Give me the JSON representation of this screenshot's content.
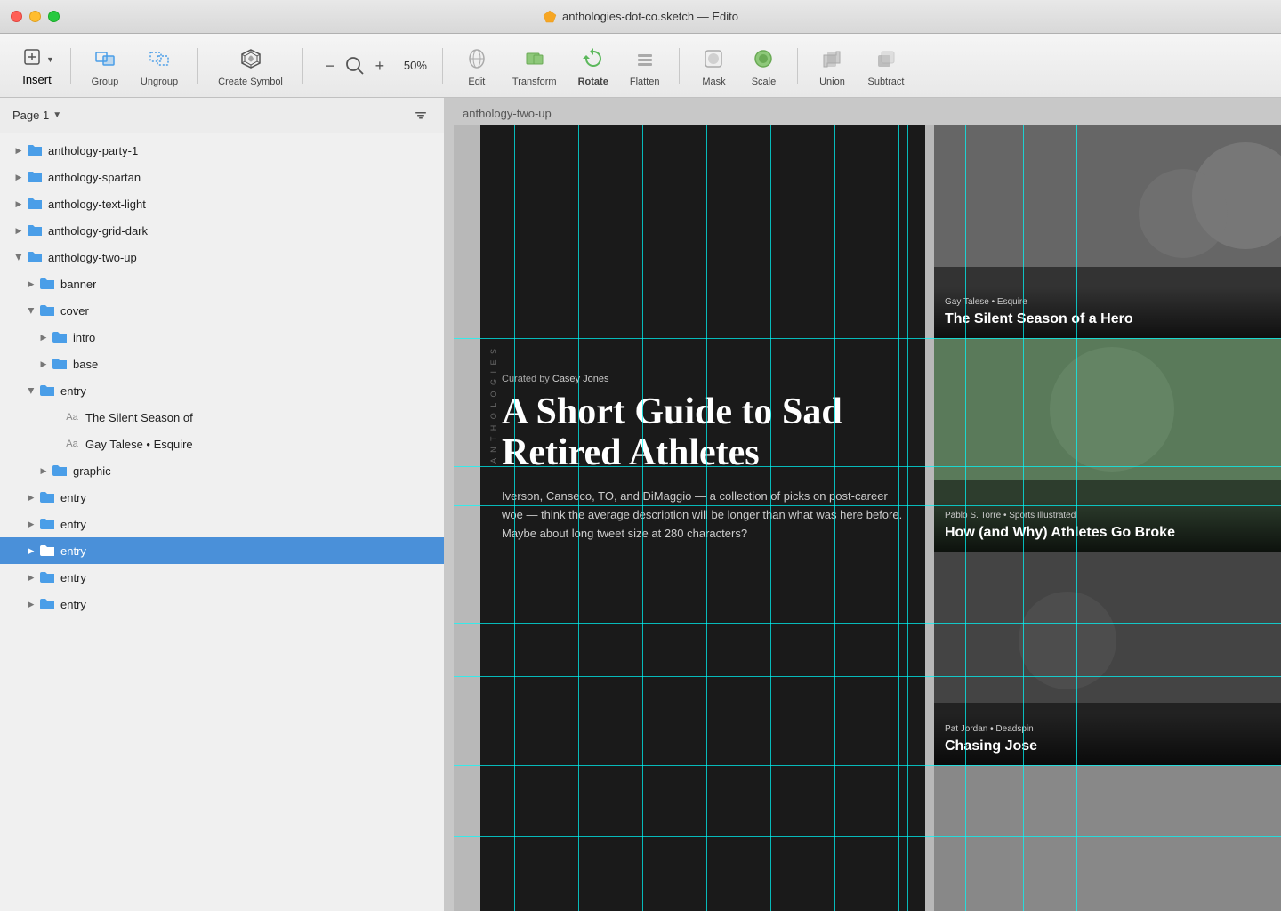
{
  "titlebar": {
    "title": "anthologies-dot-co.sketch — Edito"
  },
  "toolbar": {
    "insert_label": "Insert",
    "group_label": "Group",
    "ungroup_label": "Ungroup",
    "create_symbol_label": "Create Symbol",
    "zoom_minus": "−",
    "zoom_level": "50%",
    "zoom_plus": "+",
    "edit_label": "Edit",
    "transform_label": "Transform",
    "rotate_label": "Rotate",
    "flatten_label": "Flatten",
    "mask_label": "Mask",
    "scale_label": "Scale",
    "union_label": "Union",
    "subtract_label": "Subtract"
  },
  "sidebar": {
    "page_label": "Page 1",
    "layers": [
      {
        "id": 1,
        "name": "anthology-party-1",
        "type": "group",
        "indent": 0,
        "expanded": false,
        "selected": false
      },
      {
        "id": 2,
        "name": "anthology-spartan",
        "type": "group",
        "indent": 0,
        "expanded": false,
        "selected": false
      },
      {
        "id": 3,
        "name": "anthology-text-light",
        "type": "group",
        "indent": 0,
        "expanded": false,
        "selected": false
      },
      {
        "id": 4,
        "name": "anthology-grid-dark",
        "type": "group",
        "indent": 0,
        "expanded": false,
        "selected": false
      },
      {
        "id": 5,
        "name": "anthology-two-up",
        "type": "group",
        "indent": 0,
        "expanded": true,
        "selected": false
      },
      {
        "id": 6,
        "name": "banner",
        "type": "folder",
        "indent": 1,
        "expanded": false,
        "selected": false
      },
      {
        "id": 7,
        "name": "cover",
        "type": "folder",
        "indent": 1,
        "expanded": true,
        "selected": false
      },
      {
        "id": 8,
        "name": "intro",
        "type": "folder",
        "indent": 2,
        "expanded": false,
        "selected": false
      },
      {
        "id": 9,
        "name": "base",
        "type": "folder",
        "indent": 2,
        "expanded": false,
        "selected": false
      },
      {
        "id": 10,
        "name": "entry",
        "type": "folder",
        "indent": 1,
        "expanded": true,
        "selected": false
      },
      {
        "id": 11,
        "name": "The Silent Season of",
        "type": "text",
        "indent": 3,
        "expanded": false,
        "selected": false
      },
      {
        "id": 12,
        "name": "Gay Talese • Esquire",
        "type": "text",
        "indent": 3,
        "expanded": false,
        "selected": false
      },
      {
        "id": 13,
        "name": "graphic",
        "type": "folder",
        "indent": 2,
        "expanded": false,
        "selected": false
      },
      {
        "id": 14,
        "name": "entry",
        "type": "folder",
        "indent": 1,
        "expanded": false,
        "selected": false
      },
      {
        "id": 15,
        "name": "entry",
        "type": "folder",
        "indent": 1,
        "expanded": false,
        "selected": false
      },
      {
        "id": 16,
        "name": "entry",
        "type": "folder",
        "indent": 1,
        "expanded": false,
        "selected": true
      },
      {
        "id": 17,
        "name": "entry",
        "type": "folder",
        "indent": 1,
        "expanded": false,
        "selected": false
      },
      {
        "id": 18,
        "name": "entry",
        "type": "folder",
        "indent": 1,
        "expanded": false,
        "selected": false
      }
    ]
  },
  "canvas": {
    "artboard_label": "anthology-two-up",
    "article": {
      "curated_by": "Curated by Casey Jones",
      "title": "A Short Guide to Sad Retired Athletes",
      "body": "Iverson, Canseco, TO, and DiMaggio — a collection of picks on post-career woe — think the average description will be longer than what was here before. Maybe about long tweet size at 280 characters?"
    },
    "side_cards": [
      {
        "meta": "Gay Talese • Esquire",
        "title": "The Silent Season of a Hero"
      },
      {
        "meta": "Pablo S. Torre • Sports Illustrated",
        "title": "How (and Why) Athletes Go Broke"
      },
      {
        "meta": "Pat Jordan • Deadspin",
        "title": "Chasing Jose"
      }
    ]
  }
}
